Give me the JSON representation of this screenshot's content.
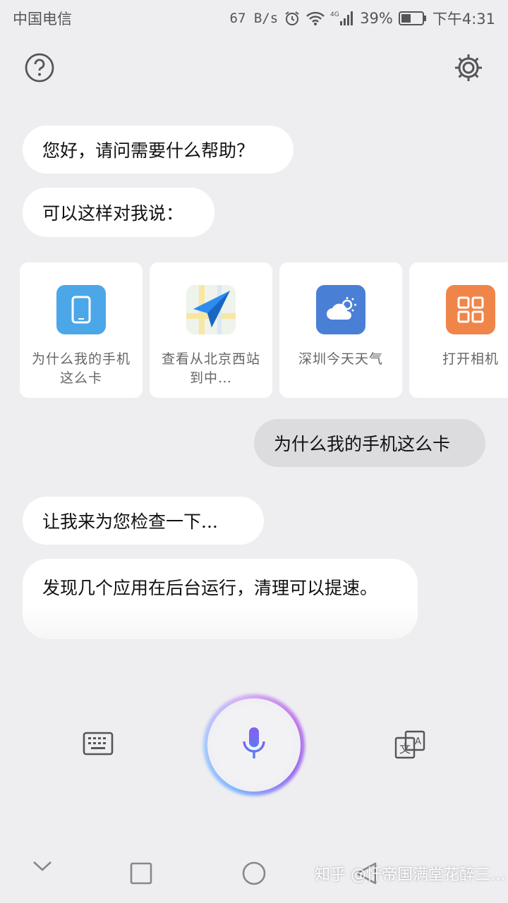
{
  "status_bar": {
    "carrier": "中国电信",
    "net_speed": "67 B/s",
    "battery_percent": "39%",
    "time": "下午4:31",
    "icons": [
      "alarm-icon",
      "wifi-icon",
      "4g-signal-icon",
      "battery-icon"
    ]
  },
  "header": {
    "help_icon": "help-circle-icon",
    "settings_icon": "gear-icon"
  },
  "conversation": {
    "greeting": "您好，请问需要什么帮助？",
    "prompt": "可以这样对我说：",
    "user_query": "为什么我的手机这么卡",
    "reply_1": "让我来为您检查一下...",
    "reply_2": "发现几个应用在后台运行，清理可以提速。"
  },
  "suggestions": [
    {
      "label": "为什么我的手机这么卡",
      "icon": "phone-icon",
      "color": "#4ba7e8"
    },
    {
      "label": "查看从北京西站到中…",
      "icon": "map-navigation-icon",
      "color": "#2d8cf0"
    },
    {
      "label": "深圳今天天气",
      "icon": "weather-icon",
      "color": "#4a7fd6"
    },
    {
      "label": "打开相机",
      "icon": "grid-app-icon",
      "color": "#f0854a"
    }
  ],
  "input_bar": {
    "keyboard_icon": "keyboard-icon",
    "mic_icon": "microphone-icon",
    "translate_icon": "translate-icon"
  },
  "nav_bar": [
    "back-chevron-icon",
    "recents-square-icon",
    "home-circle-icon",
    "back-triangle-icon"
  ],
  "watermark": "知乎 @忏帝国满堂花醉三…"
}
